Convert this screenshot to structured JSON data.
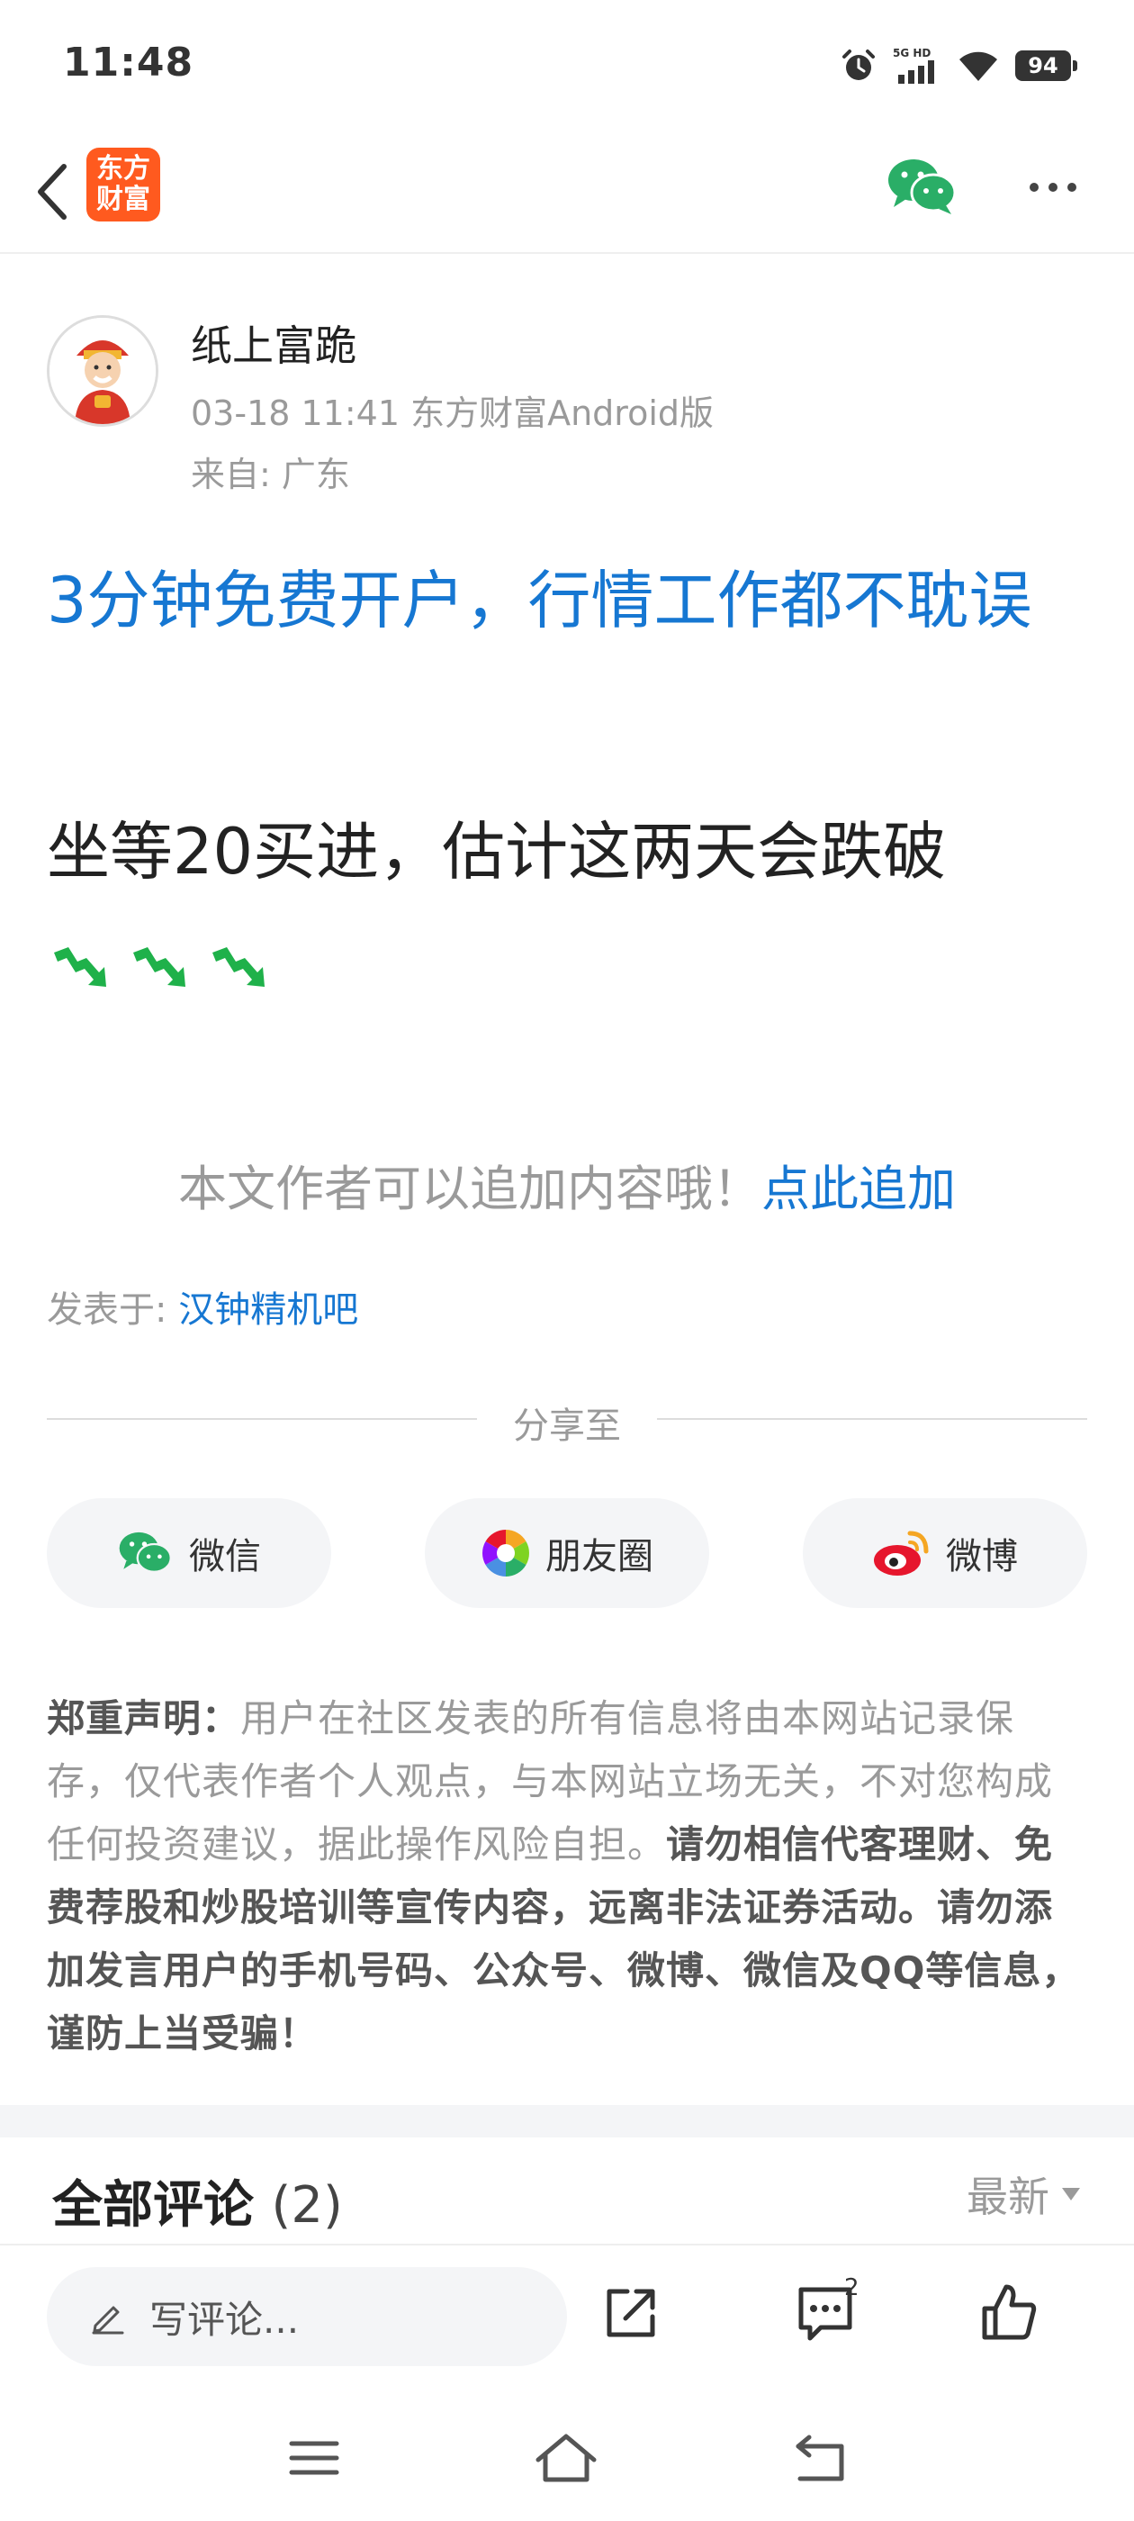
{
  "status_bar": {
    "time": "11:48",
    "network": "5G HD",
    "battery": "94"
  },
  "header": {
    "logo_line1": "东方",
    "logo_line2": "财富",
    "brand_color": "#ff5a1f"
  },
  "post": {
    "author_name": "纸上富跪",
    "meta": "03-18 11:41 东方财富Android版",
    "location": "来自: 广东",
    "promo_link": "3分钟免费开户，行情工作都不耽误",
    "content": "坐等20买进，估计这两天会跌破",
    "emoji_count": 3,
    "append_hint": "本文作者可以追加内容哦！",
    "append_link": "点此追加",
    "posted_in_label": "发表于: ",
    "posted_in_forum": "汉钟精机吧"
  },
  "share": {
    "label": "分享至",
    "buttons": [
      {
        "label": "微信",
        "icon": "wechat-icon"
      },
      {
        "label": "朋友圈",
        "icon": "moments-icon"
      },
      {
        "label": "微博",
        "icon": "weibo-icon"
      }
    ]
  },
  "disclaimer": {
    "title": "郑重声明：",
    "body": "用户在社区发表的所有信息将由本网站记录保存，仅代表作者个人观点，与本网站立场无关，不对您构成任何投资建议，据此操作风险自担。",
    "warning": "请勿相信代客理财、免费荐股和炒股培训等宣传内容，远离非法证券活动。请勿添加发言用户的手机号码、公众号、微博、微信及QQ等信息，谨防上当受骗！"
  },
  "comments": {
    "title": "全部评论",
    "count": "(2)",
    "sort": "最新"
  },
  "bottom_bar": {
    "input_placeholder": "写评论...",
    "comment_badge": "2"
  },
  "colors": {
    "link_blue": "#1677d2",
    "wechat_green": "#2aae67",
    "weibo_red": "#e6162d"
  }
}
